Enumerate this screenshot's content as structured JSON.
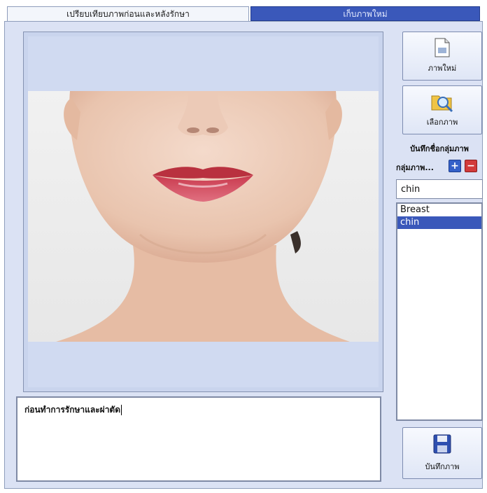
{
  "tabs": [
    {
      "label": "เปรียบเทียบภาพก่อนและหลังรักษา",
      "active": true
    },
    {
      "label": "เก็บภาพใหม่",
      "active": false
    }
  ],
  "notes": {
    "text": "ก่อนทำการรักษาและผ่าตัด"
  },
  "side": {
    "new_image_label": "ภาพใหม่",
    "choose_image_label": "เลือกภาพ",
    "group_title": "บันทึกชื่อกลุ่มภาพ",
    "group_label": "กลุ่มภาพ...",
    "add_symbol": "+",
    "remove_symbol": "−",
    "group_input_value": "chin",
    "save_label": "บันทึกภาพ"
  },
  "groups": [
    "Breast",
    "chin"
  ],
  "selected_group_index": 1,
  "colors": {
    "accent": "#3a58ba",
    "panel": "#dbe2f4",
    "add": "#3460c8",
    "remove": "#d23b3b"
  }
}
